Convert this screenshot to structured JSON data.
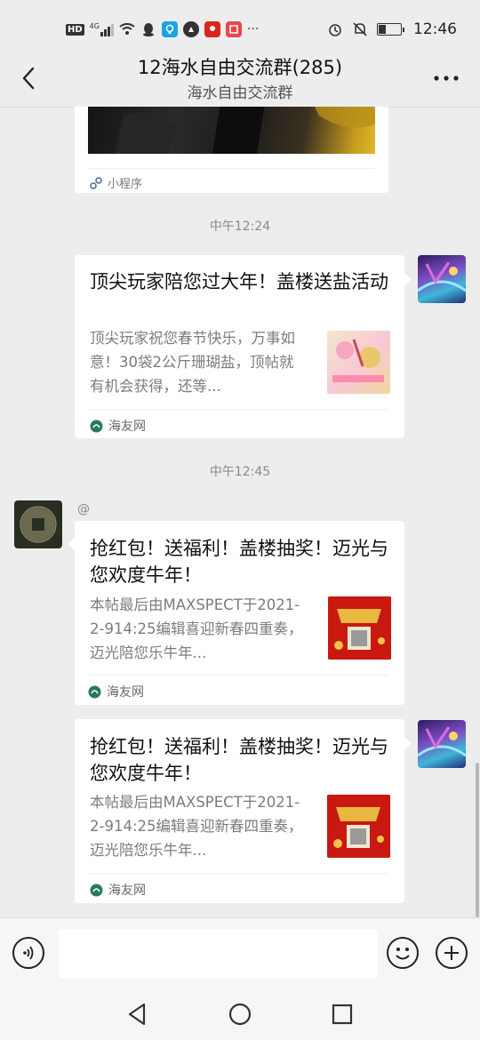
{
  "status_bar": {
    "network_label": "HD",
    "signal_label": "4G",
    "more_label": "···",
    "time": "12:46",
    "icons": [
      "hd-icon",
      "signal-icon",
      "wifi-icon",
      "qq-icon",
      "app-icon",
      "app-icon",
      "app-icon",
      "app-icon",
      "alarm-icon",
      "mute-icon",
      "battery-icon"
    ]
  },
  "header": {
    "title": "12海水自由交流群(285)",
    "subtitle": "海水自由交流群"
  },
  "messages": {
    "mini_program": {
      "source_label": "小程序"
    },
    "time_1": "中午12:24",
    "card_1": {
      "title": "顶尖玩家陪您过大年！盖楼送盐活动",
      "desc": "顶尖玩家祝您春节快乐，万事如意！30袋2公斤珊瑚盐，顶帖就有机会获得，还等...",
      "source": "海友网"
    },
    "time_2": "中午12:45",
    "sender_name": "@",
    "card_2": {
      "title": "抢红包！送福利！盖楼抽奖！迈光与您欢度牛年！",
      "desc": "本帖最后由MAXSPECT于2021-2-914:25编辑喜迎新春四重奏，迈光陪您乐牛年...",
      "source": "海友网"
    },
    "card_3": {
      "title": "抢红包！送福利！盖楼抽奖！迈光与您欢度牛年！",
      "desc": "本帖最后由MAXSPECT于2021-2-914:25编辑喜迎新春四重奏，迈光陪您乐牛年...",
      "source": "海友网"
    }
  },
  "input": {
    "placeholder": ""
  },
  "colors": {
    "background": "#ededed",
    "card": "#ffffff",
    "source_green": "#2a7a5a"
  }
}
